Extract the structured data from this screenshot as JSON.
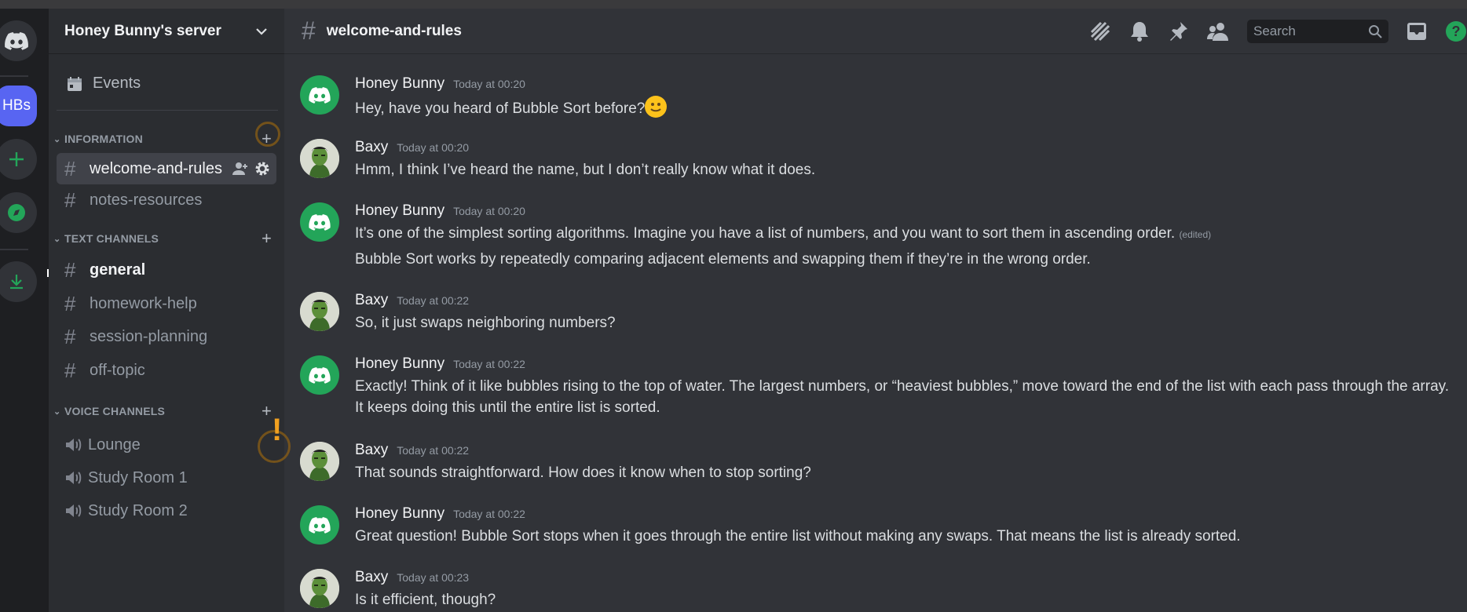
{
  "server": {
    "name": "Honey Bunny's server",
    "icon_label": "HBs"
  },
  "sidebar": {
    "events_label": "Events",
    "categories": [
      {
        "name": "INFORMATION",
        "channels": [
          "welcome-and-rules",
          "notes-resources"
        ]
      },
      {
        "name": "TEXT CHANNELS",
        "channels": [
          "general",
          "homework-help",
          "session-planning",
          "off-topic"
        ]
      },
      {
        "name": "VOICE CHANNELS",
        "channels": [
          "Lounge",
          "Study Room 1",
          "Study Room 2"
        ]
      }
    ]
  },
  "channel": {
    "name": "welcome-and-rules"
  },
  "header": {
    "search_placeholder": "Search",
    "icons": [
      "threads-icon",
      "bell-icon",
      "pin-icon",
      "members-icon",
      "search-icon",
      "inbox-icon",
      "help-icon"
    ]
  },
  "messages": [
    {
      "author": "Honey Bunny",
      "time": "Today at 00:20",
      "lines": [
        "Hey, have you heard of Bubble Sort before?"
      ],
      "emoji": "slight-smile"
    },
    {
      "author": "Baxy",
      "time": "Today at 00:20",
      "lines": [
        "Hmm, I think I’ve heard the name, but I don’t really know what it does."
      ]
    },
    {
      "author": "Honey Bunny",
      "time": "Today at 00:20",
      "lines": [
        "It’s one of the simplest sorting algorithms. Imagine you have a list of numbers, and you want to sort them in ascending order.",
        "Bubble Sort works by repeatedly comparing adjacent elements and swapping them if they’re in the wrong order."
      ],
      "edited": "(edited)"
    },
    {
      "author": "Baxy",
      "time": "Today at 00:22",
      "lines": [
        "So, it just swaps neighboring numbers?"
      ]
    },
    {
      "author": "Honey Bunny",
      "time": "Today at 00:22",
      "lines": [
        "Exactly! Think of it like bubbles rising to the top of water. The largest numbers, or “heaviest bubbles,” move toward the end of the list with each pass through the array. It keeps doing this until the entire list is sorted."
      ]
    },
    {
      "author": "Baxy",
      "time": "Today at 00:22",
      "lines": [
        "That sounds straightforward. How does it know when to stop sorting?"
      ]
    },
    {
      "author": "Honey Bunny",
      "time": "Today at 00:22",
      "lines": [
        "Great question! Bubble Sort stops when it goes through the entire list without making any swaps. That means the list is already sorted."
      ]
    },
    {
      "author": "Baxy",
      "time": "Today at 00:23",
      "lines": [
        "Is it efficient, though?"
      ]
    }
  ],
  "colors": {
    "accent": "#5865f2",
    "green": "#23a559",
    "background": "#313338",
    "sidebar": "#2b2d31",
    "rail": "#1e1f22"
  }
}
